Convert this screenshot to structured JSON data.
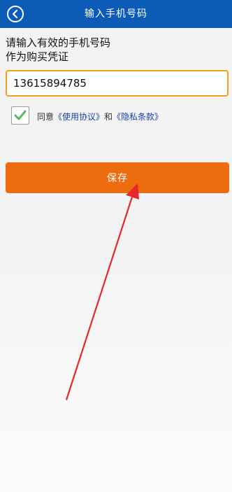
{
  "header": {
    "title": "输入手机号码",
    "back_icon": "chevron-left-icon"
  },
  "instruction": {
    "line1": "请输入有效的手机号码",
    "line2": "作为购买凭证"
  },
  "phone_input": {
    "value": "13615894785"
  },
  "agreement": {
    "checked": true,
    "prefix": "同意",
    "terms_link": "《使用协议》",
    "conjunction": "和",
    "privacy_link": "《隐私条款》"
  },
  "save_button": {
    "label": "保存"
  },
  "colors": {
    "header_bg": "#0b5bb7",
    "input_border": "#f0a01c",
    "save_button_bg": "#ed6c10",
    "link": "#1d3fa8",
    "check": "#5cb85c",
    "arrow": "#e8262b"
  }
}
